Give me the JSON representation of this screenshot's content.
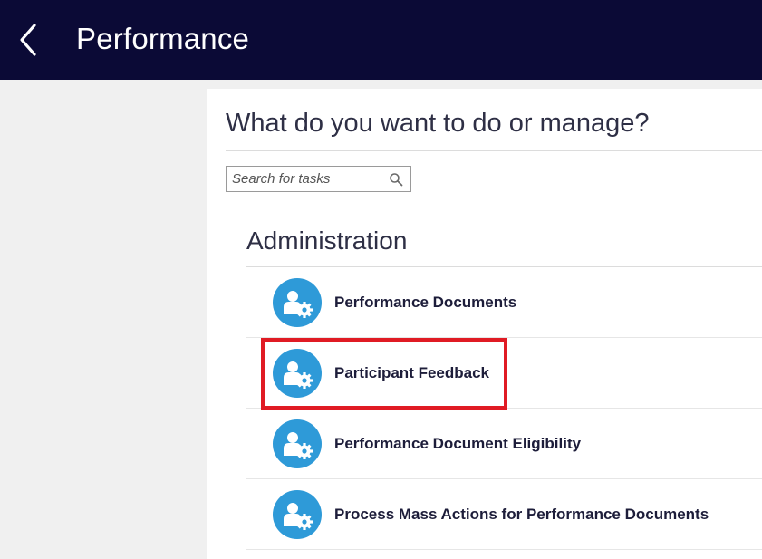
{
  "header": {
    "title": "Performance",
    "back_icon": "chevron-left-icon"
  },
  "main": {
    "question": "What do you want to do or manage?",
    "search": {
      "placeholder": "Search for tasks",
      "value": "",
      "icon": "search-icon"
    },
    "section": {
      "title": "Administration",
      "items": [
        {
          "label": "Performance Documents",
          "icon": "user-settings-icon"
        },
        {
          "label": "Participant Feedback",
          "icon": "user-settings-icon",
          "highlighted": true
        },
        {
          "label": "Performance Document Eligibility",
          "icon": "user-settings-icon"
        },
        {
          "label": "Process Mass Actions for Performance Documents",
          "icon": "user-settings-icon"
        }
      ]
    }
  },
  "colors": {
    "header_bg": "#0b0a36",
    "icon_bg": "#2e9ad8",
    "highlight_border": "#e01b24"
  }
}
